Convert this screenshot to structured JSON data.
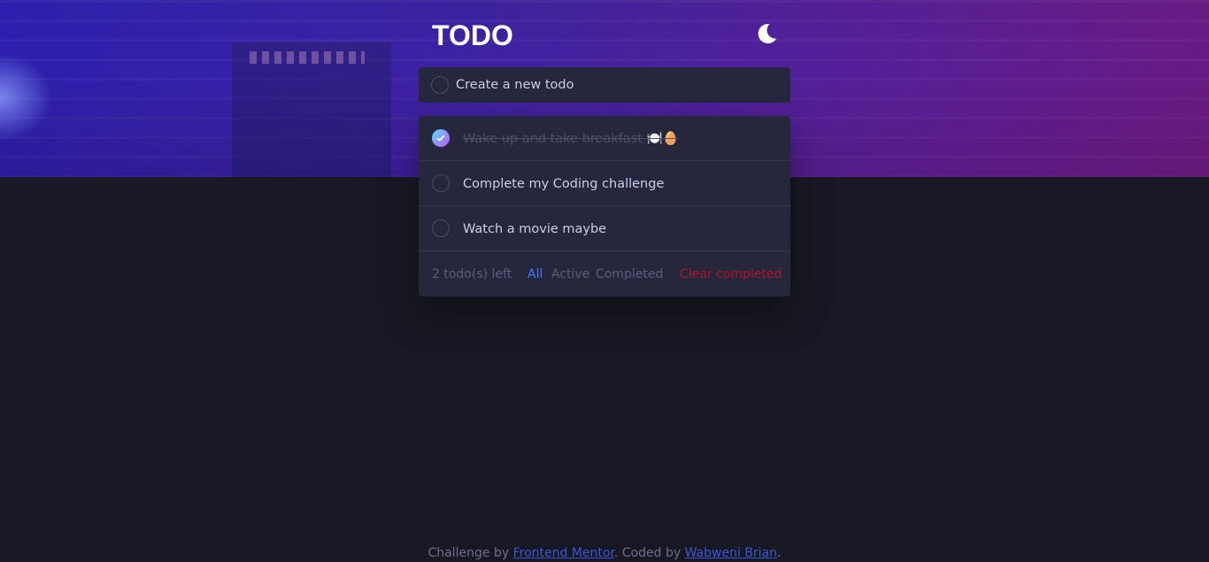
{
  "app": {
    "title": "TODO",
    "theme_icon": "moon-icon"
  },
  "new_todo": {
    "placeholder": "Create a new todo"
  },
  "todos": [
    {
      "text": "Wake up and take breakfast 🍽️🥚",
      "completed": true
    },
    {
      "text": "Complete my Coding challenge",
      "completed": false
    },
    {
      "text": "Watch a movie maybe",
      "completed": false
    }
  ],
  "footer": {
    "count_label": "2 todo(s) left",
    "filters": [
      "All",
      "Active",
      "Completed"
    ],
    "active_filter": "All",
    "clear_label": "Clear completed"
  },
  "credit": {
    "prefix": "Challenge by ",
    "link1": "Frontend Mentor",
    "middle": ". Coded by ",
    "link2": "Wabweni Brian",
    "suffix": "."
  },
  "colors": {
    "background": "#181824",
    "card": "#25273c",
    "accent_blue": "#3a7bfd",
    "danger": "#b3142a",
    "check_gradient_start": "#57ddff",
    "check_gradient_end": "#c058f3"
  }
}
